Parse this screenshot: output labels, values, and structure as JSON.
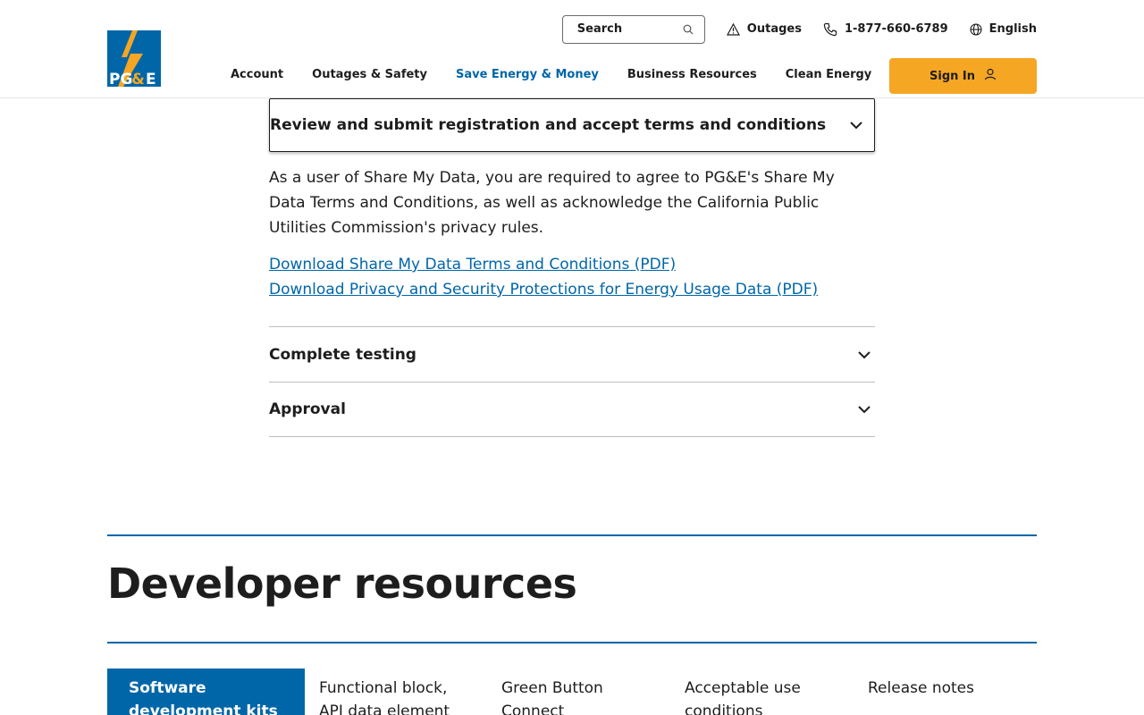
{
  "header": {
    "logo_alt": "PG&E",
    "search": {
      "placeholder": "Search"
    },
    "utility": {
      "outages_label": "Outages",
      "phone_label": "1-877-660-6789",
      "language_label": "English"
    },
    "nav": [
      {
        "label": "Account"
      },
      {
        "label": "Outages & Safety"
      },
      {
        "label": "Save Energy & Money",
        "active": true
      },
      {
        "label": "Business Resources"
      },
      {
        "label": "Clean Energy"
      }
    ],
    "signin_label": "Sign In"
  },
  "accordion": {
    "open_item": {
      "title": "Review and submit registration and accept terms and conditions",
      "body": "As a user of Share My Data, you are required to agree to PG&E's Share My Data Terms and Conditions, as well as acknowledge the California Public Utilities Commission's privacy rules.",
      "links": [
        "Download Share My Data Terms and Conditions (PDF)",
        "Download Privacy and Security Protections for Energy Usage Data (PDF)"
      ]
    },
    "collapsed_items": [
      "Complete testing",
      "Approval"
    ]
  },
  "developer": {
    "title": "Developer resources",
    "tabs": [
      {
        "label": "Software development kits",
        "active": true
      },
      {
        "label": "Functional block, API data element"
      },
      {
        "label": "Green Button Connect"
      },
      {
        "label": "Acceptable use conditions"
      },
      {
        "label": "Release notes"
      }
    ]
  },
  "colors": {
    "brand_blue": "#0066a8",
    "accent_orange": "#f5a623"
  }
}
